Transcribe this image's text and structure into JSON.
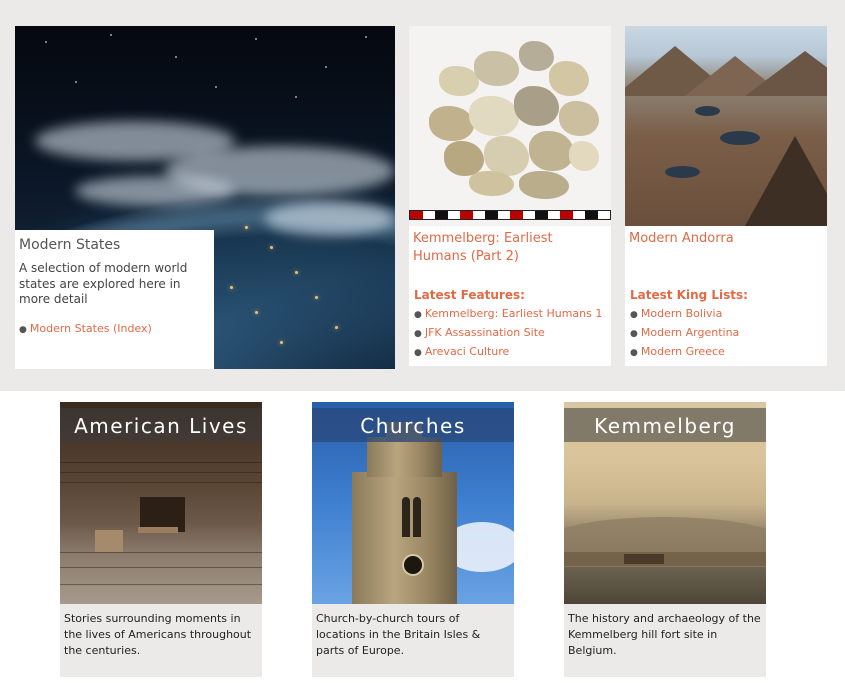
{
  "feature": {
    "title": "Modern States",
    "description": "A selection of modern world states are explored here in more detail",
    "link": "Modern States (Index)"
  },
  "cards": [
    {
      "title": "Kemmelberg: Earliest Humans (Part 2)",
      "section": "Latest Features:",
      "items": [
        "Kemmelberg: Earliest Humans 1",
        "JFK Assassination Site",
        "Arevaci Culture"
      ]
    },
    {
      "title": "Modern Andorra",
      "section": "Latest King Lists:",
      "items": [
        "Modern Bolivia",
        "Modern Argentina",
        "Modern Greece"
      ]
    }
  ],
  "tiles": [
    {
      "banner": "American Lives",
      "caption": "Stories surrounding moments in the lives of Americans throughout the centuries."
    },
    {
      "banner": "Churches",
      "caption": "Church-by-church tours of locations in the Britain Isles & parts of Europe."
    },
    {
      "banner": "Kemmelberg",
      "caption": "The history and archaeology of the Kemmelberg hill fort site in Belgium."
    }
  ],
  "colors": {
    "link": "#e06a45",
    "band": "#ebeae8"
  },
  "icons": {
    "bullet": "bullet-dot"
  }
}
